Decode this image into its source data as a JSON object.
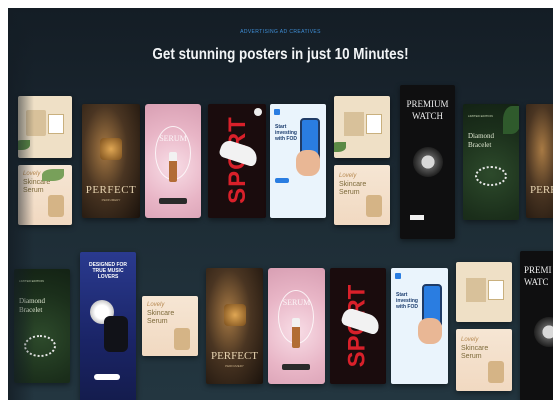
{
  "hero": {
    "kicker": "ADVERTISING AD CREATIVES",
    "headline": "Get stunning posters in just 10 Minutes!"
  },
  "posters": {
    "perfect": "PERFECT",
    "perfect_sub": "PERFUMERY",
    "serum_big": "SERUM",
    "sport": "SPORT",
    "invest": "Start investing with FOD",
    "premium": "PREMIUM",
    "watch": "WATCH",
    "lovely": "Lovely",
    "skincare": "Skincare",
    "serum": "Serum",
    "limited": "LIMITED EDITION",
    "diamond": "Diamond",
    "bracelet": "Bracelet",
    "music": "DESIGNED FOR TRUE MUSIC LOVERS",
    "prem_cut": "PREMI",
    "watch_cut": "WATC"
  },
  "colors": {
    "bg_top": "#141d25",
    "bg_bottom": "#233640",
    "accent": "#3f8fd8",
    "headline": "#f2f4f6"
  }
}
